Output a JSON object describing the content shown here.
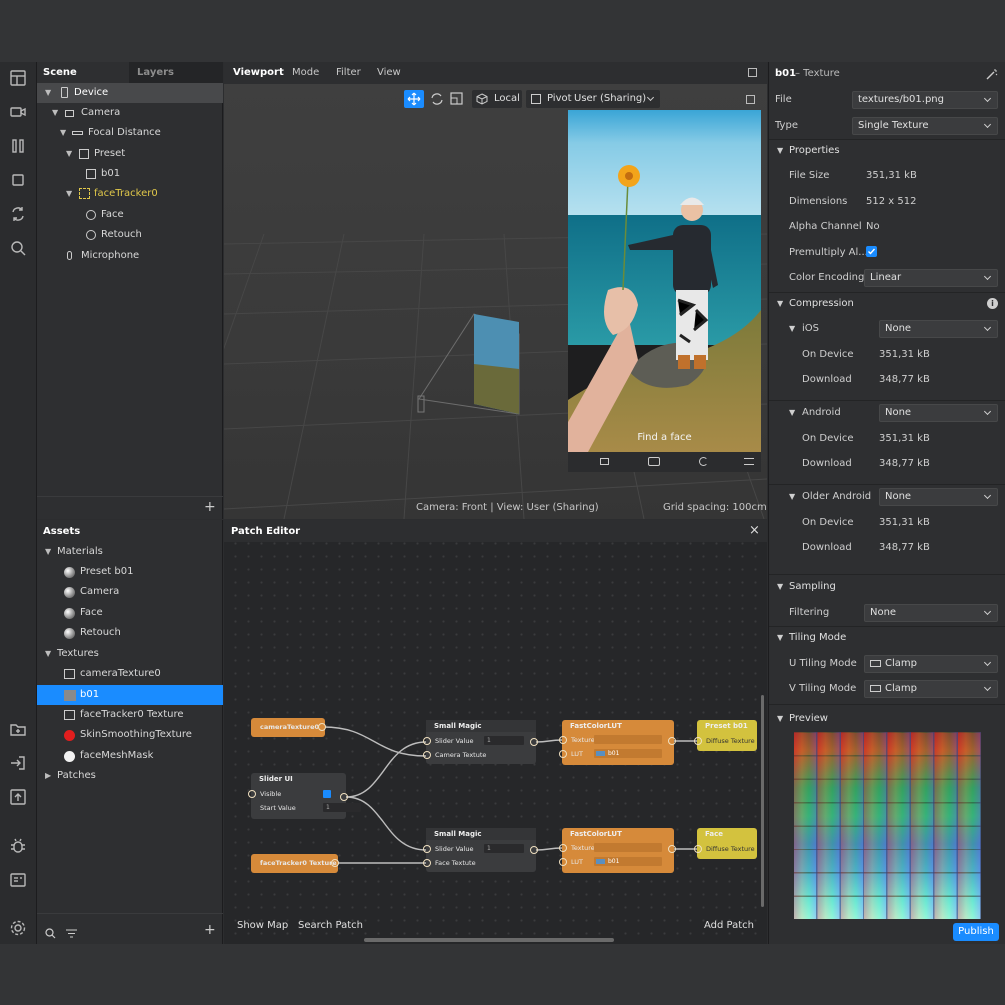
{
  "toolbar": {
    "icons": [
      "layout-icon",
      "camera-icon",
      "columns-icon",
      "square-icon",
      "sync-icon",
      "search-icon",
      "add-folder-icon",
      "import-icon",
      "upload-icon",
      "bug-icon",
      "console-icon",
      "settings-icon"
    ]
  },
  "scene": {
    "tab_scene": "Scene",
    "tab_layers": "Layers",
    "items": [
      {
        "label": "Device",
        "icon": "device-icon"
      },
      {
        "label": "Camera",
        "icon": "camera-icon"
      },
      {
        "label": "Focal Distance",
        "icon": "focal-icon"
      },
      {
        "label": "Preset",
        "icon": "preset-icon"
      },
      {
        "label": "b01",
        "icon": "rect-icon"
      },
      {
        "label": "faceTracker0",
        "icon": "face-tracker-icon"
      },
      {
        "label": "Face",
        "icon": "mesh-icon"
      },
      {
        "label": "Retouch",
        "icon": "mesh-icon"
      },
      {
        "label": "Microphone",
        "icon": "microphone-icon"
      }
    ],
    "add_label": "+"
  },
  "viewport": {
    "tabs": [
      "Viewport",
      "Mode",
      "Filter",
      "View"
    ],
    "local_label": "Local",
    "pivot_label": "Pivot",
    "sim_label": "User (Sharing)",
    "find_face": "Find a face",
    "status_left": "Camera: Front | View: User (Sharing)",
    "status_right": "Grid spacing: 100cm"
  },
  "assets": {
    "title": "Assets",
    "materials_label": "Materials",
    "materials": [
      "Preset b01",
      "Camera",
      "Face",
      "Retouch"
    ],
    "textures_label": "Textures",
    "textures": [
      "cameraTexture0",
      "b01",
      "faceTracker0 Texture",
      "SkinSmoothingTexture",
      "faceMeshMask"
    ],
    "patches_label": "Patches",
    "add_label": "+"
  },
  "patch": {
    "title": "Patch Editor",
    "close": "×",
    "show_map": "Show Map",
    "search_patch": "Search Patch",
    "add_patch": "Add Patch",
    "nodes": {
      "cam_tex": "cameraTexture0",
      "slider_ui": "Slider UI",
      "visible": "Visible",
      "start_value": "Start Value",
      "start_value_val": "1",
      "face_tex": "faceTracker0 Texture",
      "small_magic": "Small Magic",
      "slider_value": "Slider Value",
      "slider_value_val": "1",
      "camera_textute": "Camera Textute",
      "face_textute": "Face Textute",
      "fast_lut": "FastColorLUT",
      "texture": "Texture",
      "lut": "LUT",
      "lut_val": "b01",
      "preset_b01": "Preset b01",
      "face": "Face",
      "diffuse_texture": "Diffuse Texture"
    }
  },
  "props": {
    "title": "b01",
    "subtitle": "– Texture",
    "file_label": "File",
    "file_value": "textures/b01.png",
    "type_label": "Type",
    "type_value": "Single Texture",
    "properties": "Properties",
    "file_size_label": "File Size",
    "file_size": "351,31 kB",
    "dimensions_label": "Dimensions",
    "dimensions": "512 x 512",
    "alpha_label": "Alpha Channel",
    "alpha": "No",
    "premult_label": "Premultiply Al...",
    "color_enc_label": "Color Encoding",
    "color_enc": "Linear",
    "compression": "Compression",
    "ios": "iOS",
    "android": "Android",
    "older_android": "Older Android",
    "none": "None",
    "on_device": "On Device",
    "download": "Download",
    "ios_on_device": "351,31 kB",
    "ios_download": "348,77 kB",
    "and_on_device": "351,31 kB",
    "and_download": "348,77 kB",
    "old_on_device": "351,31 kB",
    "old_download": "348,77 kB",
    "sampling": "Sampling",
    "filtering_label": "Filtering",
    "filtering": "None",
    "tiling": "Tiling Mode",
    "u_tiling_label": "U Tiling Mode",
    "v_tiling_label": "V Tiling Mode",
    "clamp": "Clamp",
    "preview": "Preview",
    "publish": "Publish"
  },
  "colors": {
    "accent": "#1a8cff",
    "node_orange": "#d68a3a",
    "node_yellow": "#d3c23e",
    "face_tracker": "#e0c84a"
  }
}
